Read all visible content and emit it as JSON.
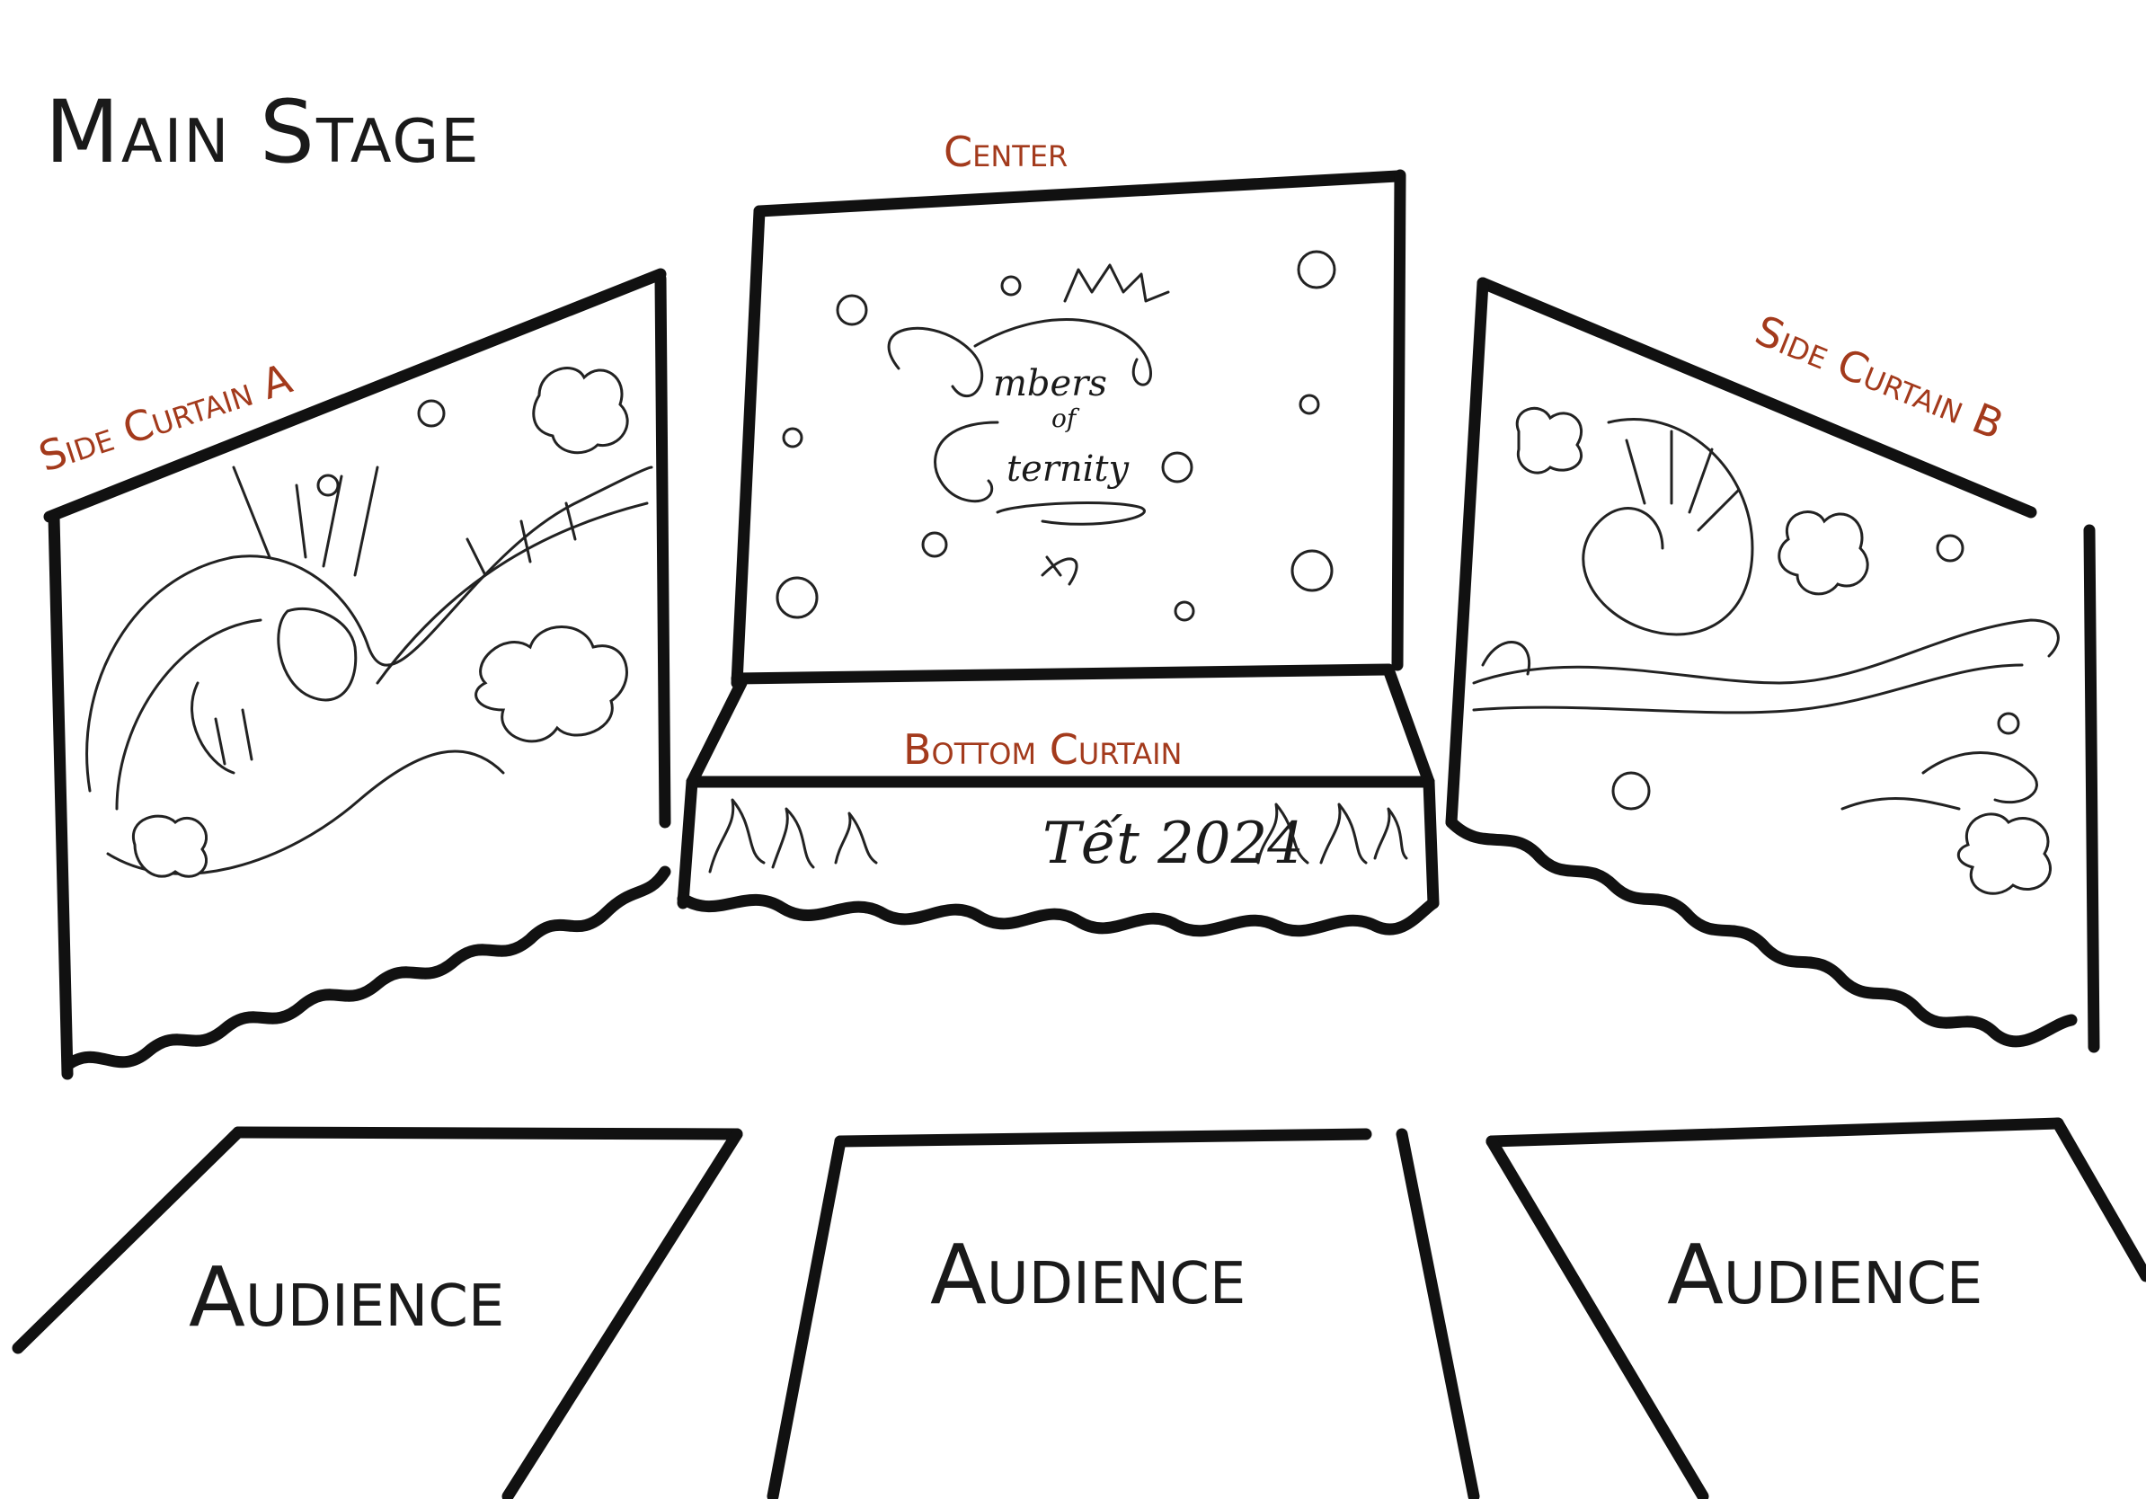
{
  "title": "Main Stage",
  "labels": {
    "center": "Center",
    "side_a": "Side Curtain A",
    "side_b": "Side Curtain B",
    "bottom": "Bottom Curtain"
  },
  "center_banner": {
    "line1": "mbers",
    "line2": "of",
    "line3": "ternity"
  },
  "bottom_banner": {
    "text": "Tết 2024"
  },
  "audience": [
    "Audience",
    "Audience",
    "Audience"
  ],
  "colors": {
    "label": "#a33a1c",
    "ink": "#111111",
    "background": "#ffffff"
  },
  "icons": [
    "dragon-illustration",
    "flower-icon",
    "cloud-icon",
    "flame-icon"
  ]
}
